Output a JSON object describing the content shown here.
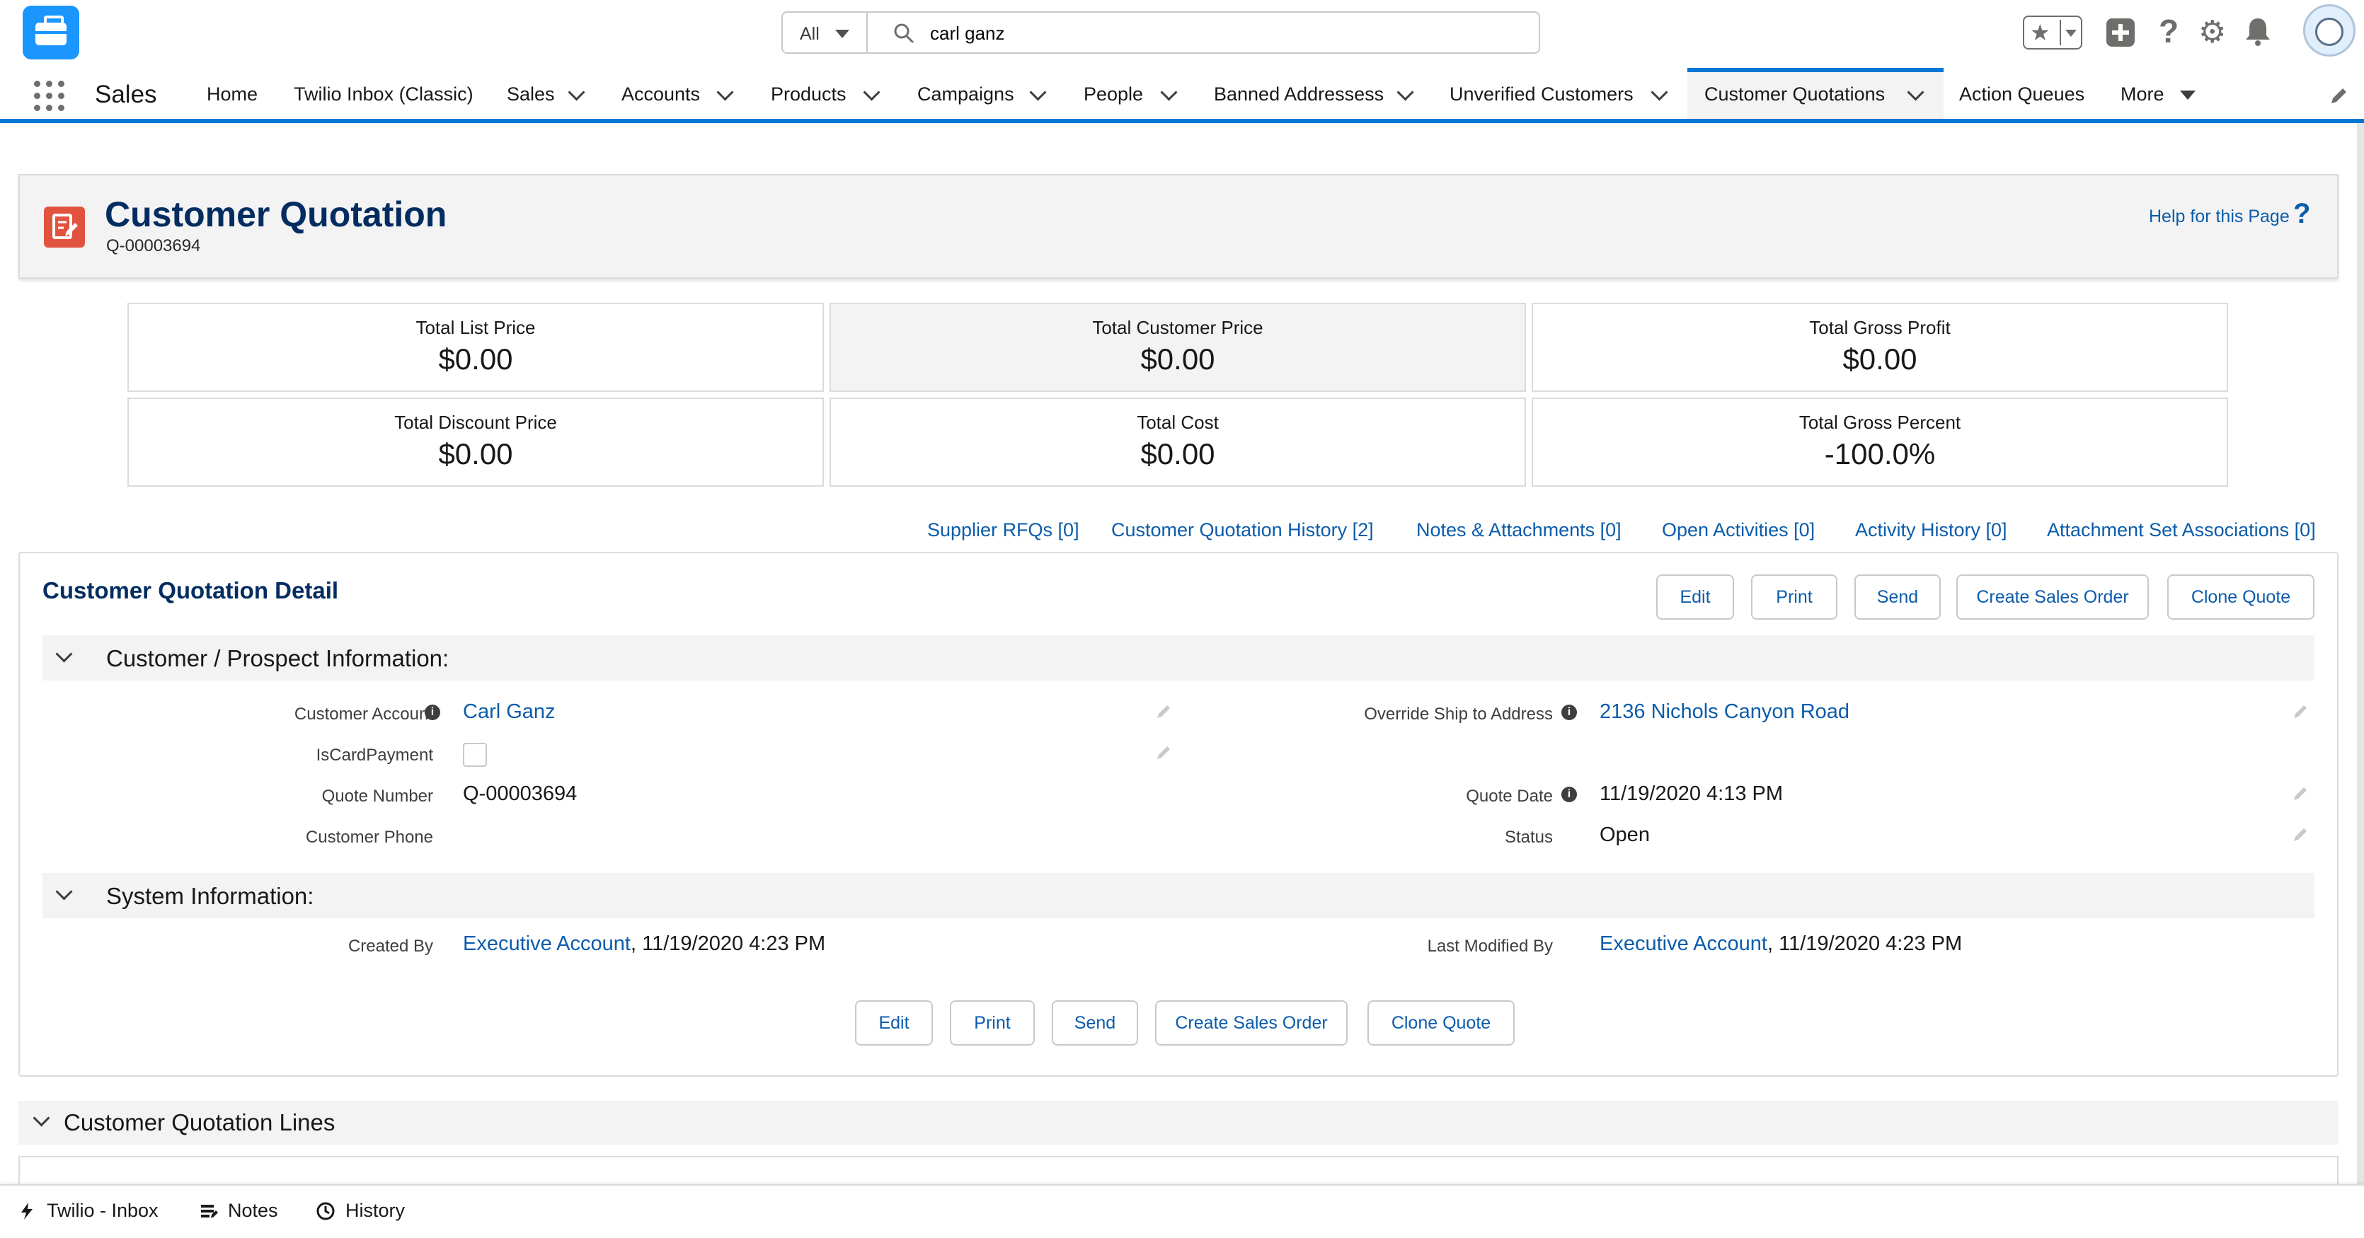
{
  "search": {
    "scope": "All",
    "value": "carl ganz"
  },
  "app": {
    "name": "Sales"
  },
  "nav": {
    "items": [
      {
        "label": "Home"
      },
      {
        "label": "Twilio Inbox (Classic)"
      },
      {
        "label": "Sales"
      },
      {
        "label": "Accounts"
      },
      {
        "label": "Products"
      },
      {
        "label": "Campaigns"
      },
      {
        "label": "People"
      },
      {
        "label": "Banned Addressess"
      },
      {
        "label": "Unverified Customers"
      },
      {
        "label": "Customer Quotations"
      },
      {
        "label": "Action Queues"
      },
      {
        "label": "More"
      }
    ],
    "active": "Customer Quotations"
  },
  "page": {
    "title": "Customer Quotation",
    "record_number": "Q-00003694",
    "help_link": "Help for this Page",
    "help_icon": "?"
  },
  "metrics": [
    {
      "label": "Total List Price",
      "value": "$0.00"
    },
    {
      "label": "Total Customer Price",
      "value": "$0.00"
    },
    {
      "label": "Total Gross Profit",
      "value": "$0.00"
    },
    {
      "label": "Total Discount Price",
      "value": "$0.00"
    },
    {
      "label": "Total Cost",
      "value": "$0.00"
    },
    {
      "label": "Total Gross Percent",
      "value": "-100.0%"
    }
  ],
  "related_links": [
    "Supplier RFQs [0]",
    "Customer Quotation History [2]",
    "Notes & Attachments [0]",
    "Open Activities [0]",
    "Activity History [0]",
    "Attachment Set Associations [0]"
  ],
  "detail": {
    "title": "Customer Quotation Detail",
    "buttons": [
      "Edit",
      "Print",
      "Send",
      "Create Sales Order",
      "Clone Quote"
    ],
    "section_customer": "Customer / Prospect Information:",
    "section_system": "System Information:",
    "fields": {
      "customer_account_label": "Customer Account",
      "customer_account_value": "Carl Ganz",
      "is_card_payment_label": "IsCardPayment",
      "quote_number_label": "Quote Number",
      "quote_number_value": "Q-00003694",
      "customer_phone_label": "Customer Phone",
      "override_ship_label": "Override Ship to Address",
      "override_ship_value": "2136 Nichols Canyon Road",
      "quote_date_label": "Quote Date",
      "quote_date_value": "11/19/2020 4:13 PM",
      "status_label": "Status",
      "status_value": "Open",
      "created_by_label": "Created By",
      "created_by_user": "Executive Account",
      "created_by_date": ", 11/19/2020 4:23 PM",
      "last_modified_label": "Last Modified By",
      "last_modified_user": "Executive Account",
      "last_modified_date": ", 11/19/2020 4:23 PM"
    }
  },
  "lines_section": {
    "title": "Customer Quotation Lines"
  },
  "utility_bar": [
    {
      "label": "Twilio - Inbox",
      "icon": "lightning-icon"
    },
    {
      "label": "Notes",
      "icon": "notes-icon"
    },
    {
      "label": "History",
      "icon": "clock-icon"
    }
  ],
  "colors": {
    "brand_blue": "#0176d3",
    "link_blue": "#0b5cab",
    "title_navy": "#032d60",
    "record_icon": "#e1533e"
  }
}
